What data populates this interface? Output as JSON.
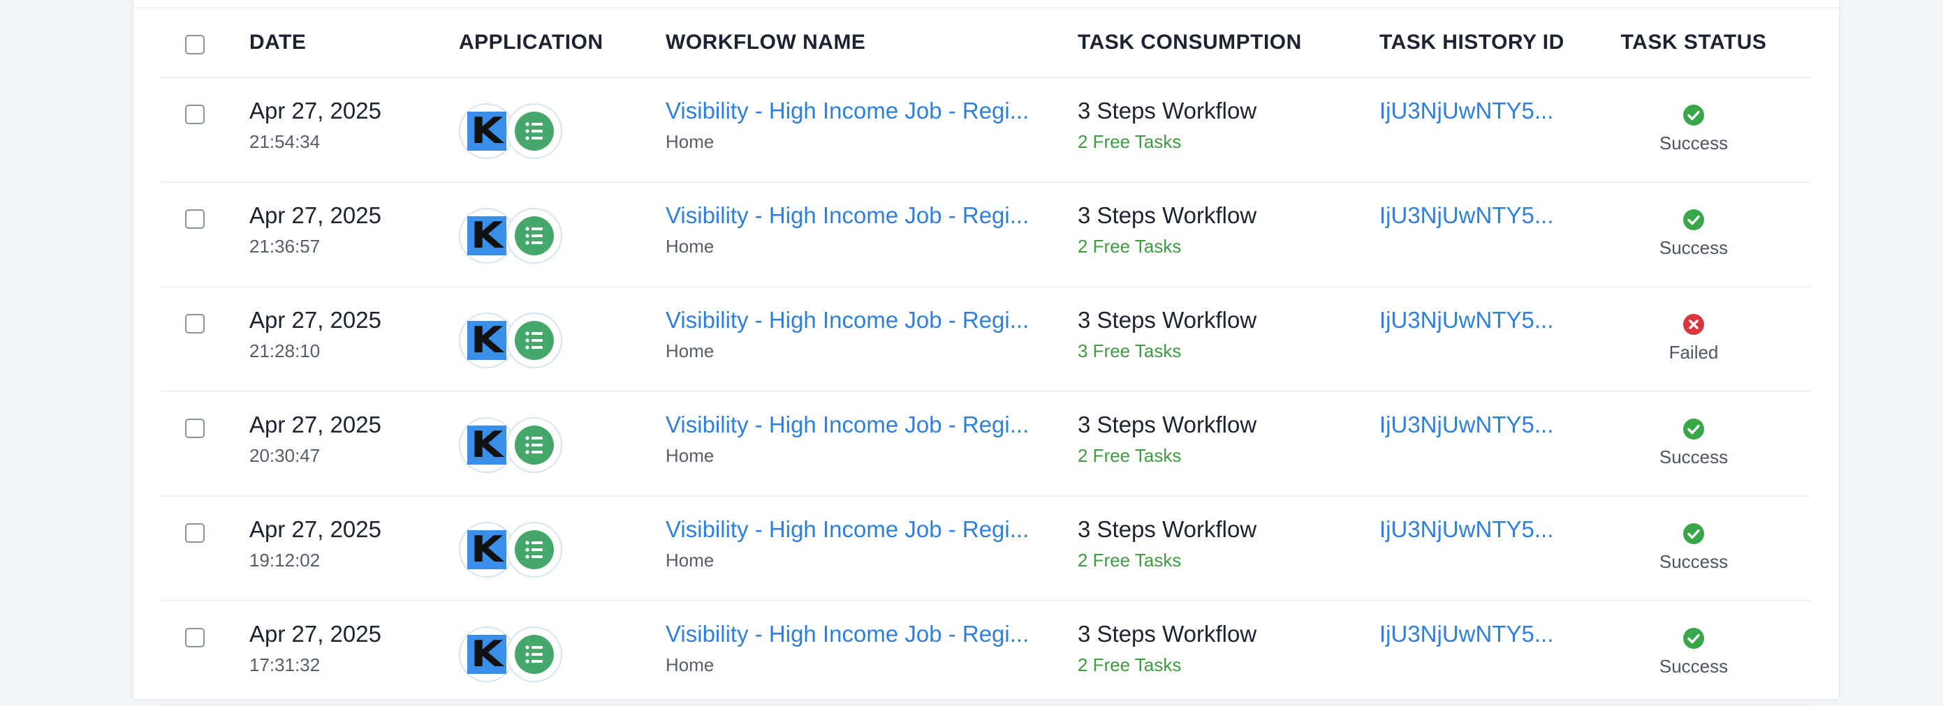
{
  "colors": {
    "link": "#2f7fdc",
    "free_tasks": "#3f9a42",
    "success": "#3aa64a",
    "failed": "#d9363e",
    "app_k_bg": "#3a8fe8",
    "app_list_bg": "#45a86a"
  },
  "headers": {
    "date": "DATE",
    "application": "APPLICATION",
    "workflow_name": "WORKFLOW NAME",
    "task_consumption": "TASK CONSUMPTION",
    "task_history_id": "TASK HISTORY ID",
    "task_status": "TASK STATUS"
  },
  "rows": [
    {
      "date": "Apr 27, 2025",
      "time": "21:54:34",
      "apps": [
        "k-app-icon",
        "list-app-icon"
      ],
      "workflow": "Visibility - High Income Job - Regi...",
      "workflow_folder": "Home",
      "steps": "3 Steps Workflow",
      "tasks": "2 Free Tasks",
      "history_id": "IjU3NjUwNTY5...",
      "status": "Success",
      "status_type": "success"
    },
    {
      "date": "Apr 27, 2025",
      "time": "21:36:57",
      "apps": [
        "k-app-icon",
        "list-app-icon"
      ],
      "workflow": "Visibility - High Income Job - Regi...",
      "workflow_folder": "Home",
      "steps": "3 Steps Workflow",
      "tasks": "2 Free Tasks",
      "history_id": "IjU3NjUwNTY5...",
      "status": "Success",
      "status_type": "success"
    },
    {
      "date": "Apr 27, 2025",
      "time": "21:28:10",
      "apps": [
        "k-app-icon",
        "list-app-icon"
      ],
      "workflow": "Visibility - High Income Job - Regi...",
      "workflow_folder": "Home",
      "steps": "3 Steps Workflow",
      "tasks": "3 Free Tasks",
      "history_id": "IjU3NjUwNTY5...",
      "status": "Failed",
      "status_type": "failed"
    },
    {
      "date": "Apr 27, 2025",
      "time": "20:30:47",
      "apps": [
        "k-app-icon",
        "list-app-icon"
      ],
      "workflow": "Visibility - High Income Job - Regi...",
      "workflow_folder": "Home",
      "steps": "3 Steps Workflow",
      "tasks": "2 Free Tasks",
      "history_id": "IjU3NjUwNTY5...",
      "status": "Success",
      "status_type": "success"
    },
    {
      "date": "Apr 27, 2025",
      "time": "19:12:02",
      "apps": [
        "k-app-icon",
        "list-app-icon"
      ],
      "workflow": "Visibility - High Income Job - Regi...",
      "workflow_folder": "Home",
      "steps": "3 Steps Workflow",
      "tasks": "2 Free Tasks",
      "history_id": "IjU3NjUwNTY5...",
      "status": "Success",
      "status_type": "success"
    },
    {
      "date": "Apr 27, 2025",
      "time": "17:31:32",
      "apps": [
        "k-app-icon",
        "list-app-icon"
      ],
      "workflow": "Visibility - High Income Job - Regi...",
      "workflow_folder": "Home",
      "steps": "3 Steps Workflow",
      "tasks": "2 Free Tasks",
      "history_id": "IjU3NjUwNTY5...",
      "status": "Success",
      "status_type": "success"
    }
  ]
}
